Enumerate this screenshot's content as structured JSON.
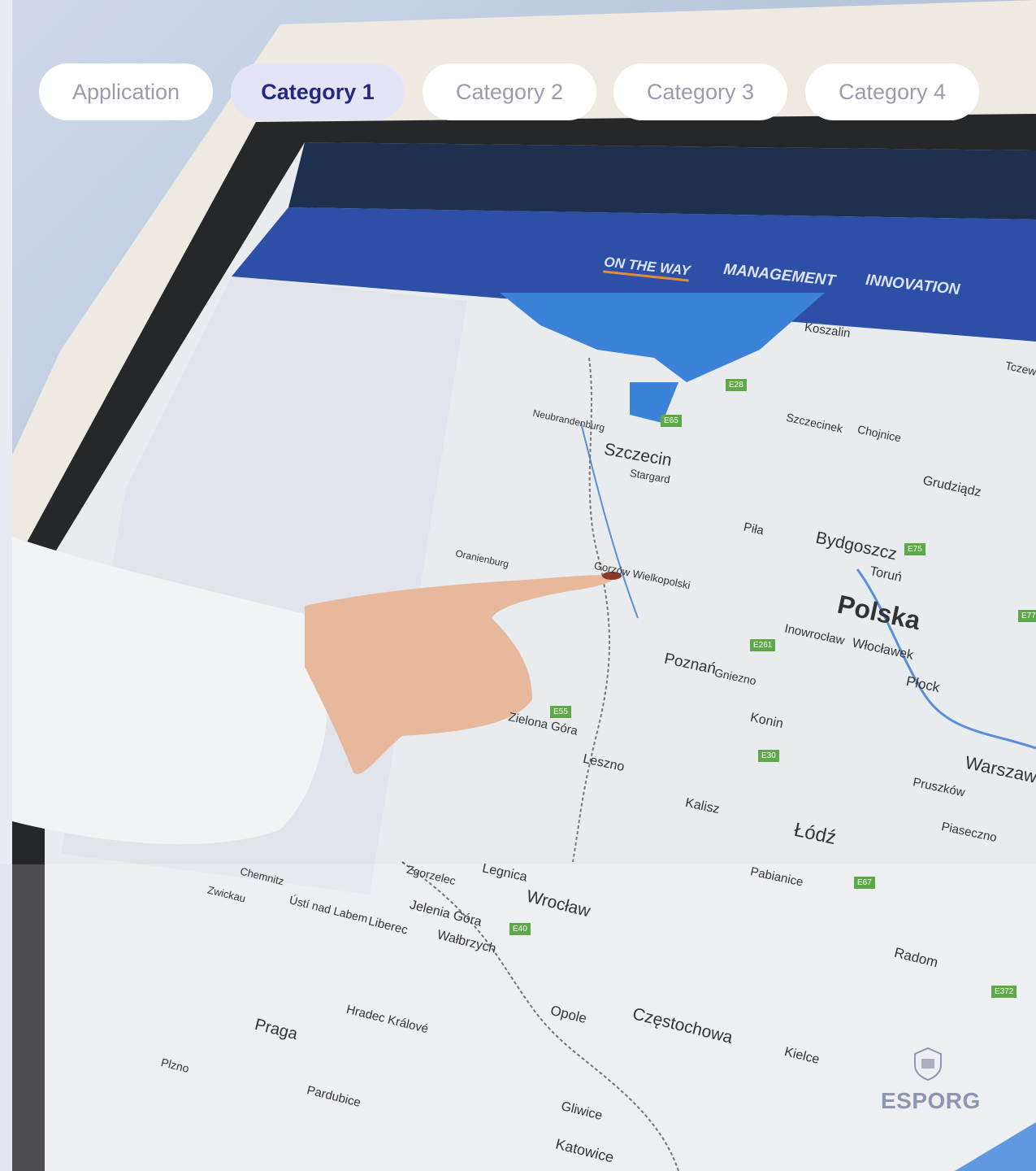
{
  "tabs": [
    {
      "label": "Application",
      "active": false
    },
    {
      "label": "Category 1",
      "active": true
    },
    {
      "label": "Category 2",
      "active": false
    },
    {
      "label": "Category 3",
      "active": false
    },
    {
      "label": "Category 4",
      "active": false
    }
  ],
  "screen_nav": {
    "items": [
      "ON THE WAY",
      "MANAGEMENT",
      "INNOVATION"
    ]
  },
  "map_labels": [
    "Koszalin",
    "Szczecin",
    "Stargard",
    "Szczecinek",
    "Chojnice",
    "Grudziądz",
    "Piła",
    "Bydgoszcz",
    "Toruń",
    "Polska",
    "Inowrocław",
    "Włocławek",
    "Płock",
    "Poznań",
    "Gniezno",
    "Konin",
    "Zielona Góra",
    "Leszno",
    "Kalisz",
    "Łódź",
    "Warszawa",
    "Pruszków",
    "Piaseczno",
    "Pabianice",
    "Legnica",
    "Wrocław",
    "Wałbrzych",
    "Jelenia Góra",
    "Zgorzelec",
    "Liberec",
    "Ústí nad Labem",
    "Praga",
    "Hradec Králové",
    "Pardubice",
    "Plzno",
    "Opole",
    "Częstochowa",
    "Kielce",
    "Radom",
    "Gliwice",
    "Katowice",
    "Gorzów Wielkopolski",
    "Chemnitz",
    "Zwickau",
    "Tczew",
    "Oranienburg",
    "Neubrandenburg"
  ],
  "road_badges": [
    "E28",
    "E65",
    "E75",
    "E77",
    "E261",
    "E30",
    "E67",
    "E40",
    "E55",
    "E372"
  ],
  "logo": {
    "text": "ESPORG"
  },
  "colors": {
    "tab_active_bg": "#e3e4f6",
    "tab_active_text": "#242a7c",
    "tab_inactive_text": "#9a9cab",
    "screen_header": "#2d4fa6",
    "map_land": "#e8ebee",
    "map_water": "#3b82d8",
    "road_badge": "#5fa84a"
  }
}
